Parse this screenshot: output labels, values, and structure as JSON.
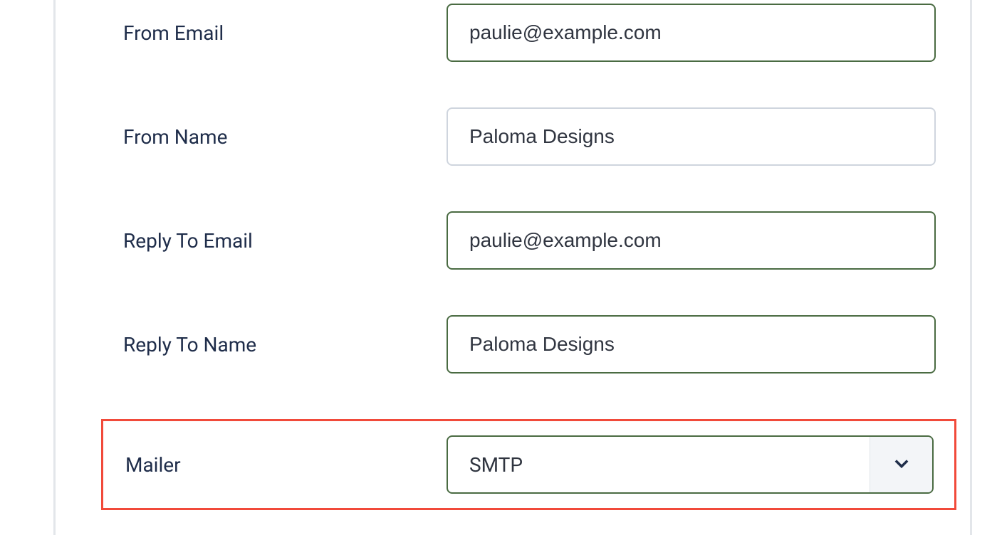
{
  "form": {
    "fromEmail": {
      "label": "From Email",
      "value": "paulie@example.com"
    },
    "fromName": {
      "label": "From Name",
      "value": "Paloma Designs"
    },
    "replyToEmail": {
      "label": "Reply To Email",
      "value": "paulie@example.com"
    },
    "replyToName": {
      "label": "Reply To Name",
      "value": "Paloma Designs"
    },
    "mailer": {
      "label": "Mailer",
      "value": "SMTP"
    }
  }
}
